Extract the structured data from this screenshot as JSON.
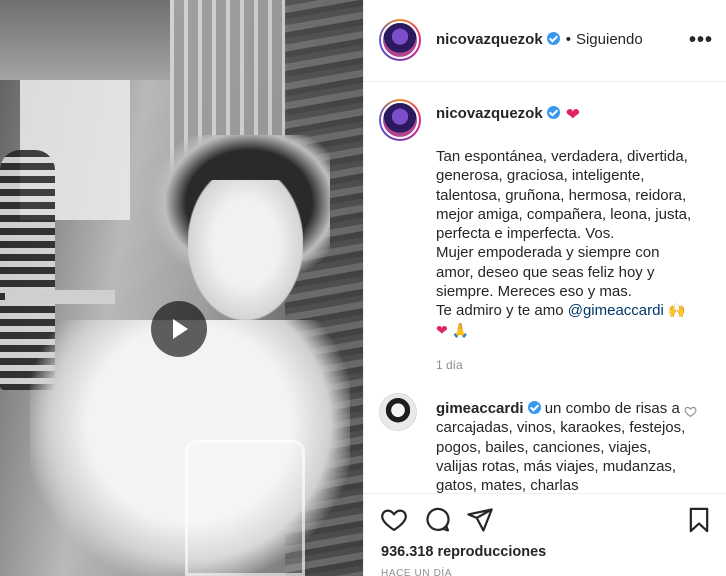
{
  "header": {
    "username": "nicovazquezok",
    "separator": "•",
    "follow_status": "Siguiendo",
    "more_label": "•••"
  },
  "caption": {
    "username": "nicovazquezok",
    "heart": "❤",
    "text": "Tan espontánea, verdadera, divertida,\ngenerosa, graciosa, inteligente,\ntalentosa, gruñona, hermosa, reidora,\nmejor amiga, compañera, leona, justa,\nperfecta e imperfecta. Vos.\nMujer empoderada y siempre con\namor, deseo que seas feliz hoy y\nsiempre. Mereces eso y mas.\nTe admiro y te amo ",
    "mention": "@gimeaccardi",
    "emoji_hands": "🙌",
    "emoji_heart": "❤",
    "emoji_pray": "🙏",
    "time": "1 día"
  },
  "comment": {
    "username": "gimeaccardi",
    "text": " un combo de risas a carcajadas, vinos, karaokes, festejos, pogos, bailes, canciones, viajes, valijas rotas, más viajes, mudanzas, gatos, mates, charlas"
  },
  "actions": {
    "views": "936.318 reproducciones",
    "timestamp": "HACE UN DÍA"
  },
  "colors": {
    "verified": "#3897f0",
    "heart": "#e0245e",
    "mention": "#00376b",
    "muted": "#8e8e8e"
  },
  "icons": [
    "play-icon",
    "more-icon",
    "verified-icon",
    "heart-icon",
    "comment-icon",
    "share-icon",
    "bookmark-icon"
  ]
}
